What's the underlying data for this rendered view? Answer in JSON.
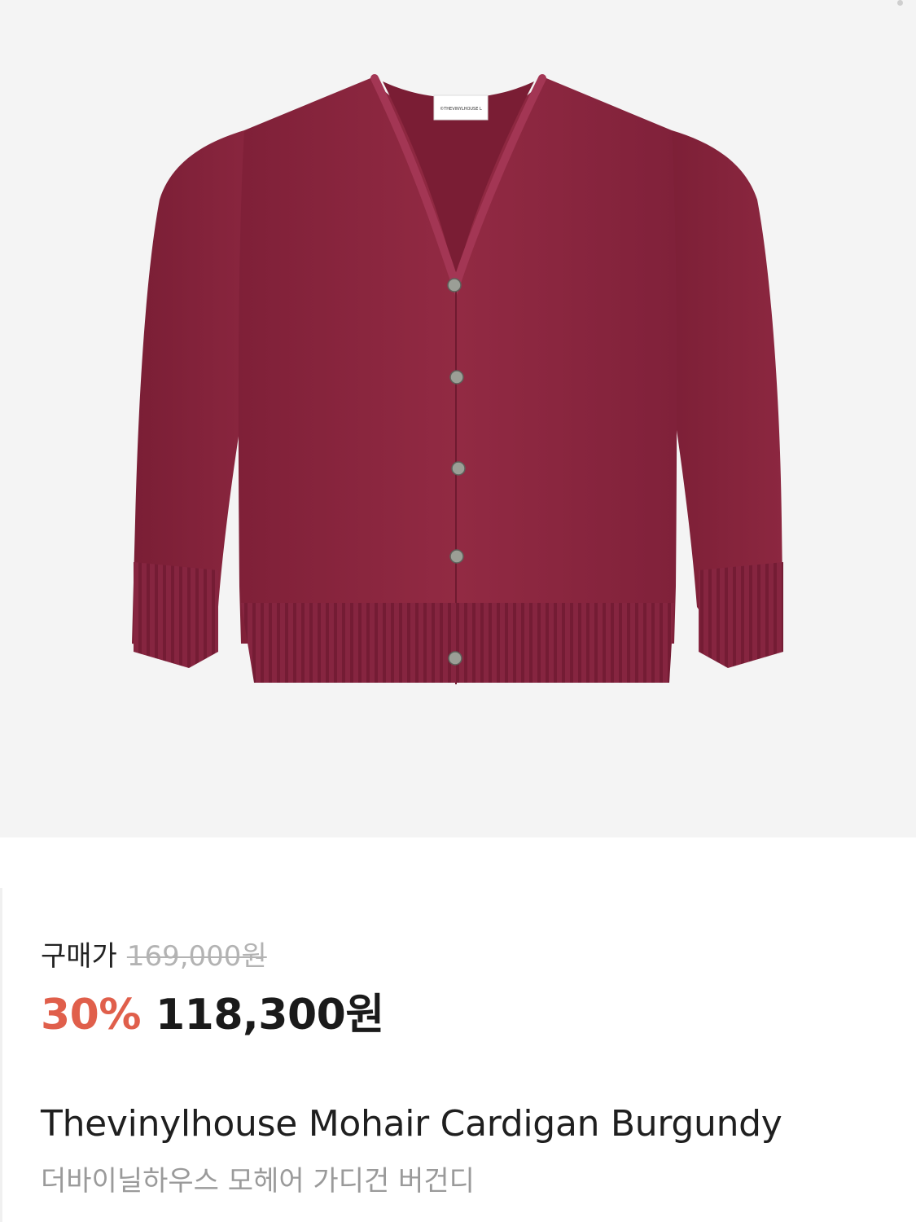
{
  "product": {
    "image_icon": "burgundy-cardigan-photo",
    "background_color": "#f4f4f4",
    "garment_color": "#8e2740",
    "label_text": "©THEVINYLHOUSE",
    "label_size": "L"
  },
  "pricing": {
    "label": "구매가",
    "original_price": "169,000원",
    "discount_rate": "30%",
    "sale_price": "118,300원",
    "discount_color": "#e05f4b"
  },
  "title": {
    "english": "Thevinylhouse Mohair Cardigan Burgundy",
    "korean": "더바이닐하우스 모헤어 가디건 버건디"
  }
}
